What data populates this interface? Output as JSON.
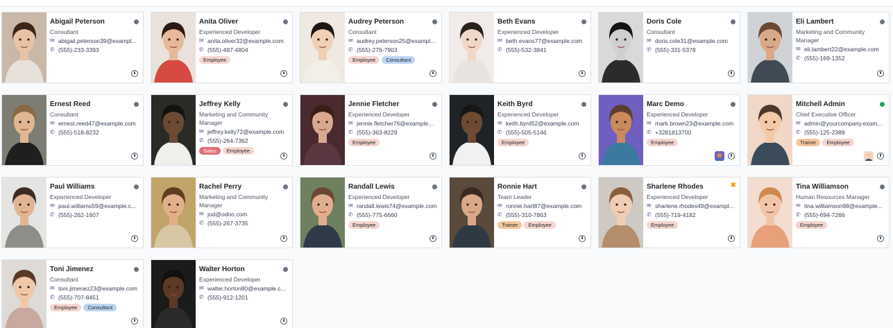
{
  "employees": [
    {
      "name": "Abigail Peterson",
      "job": "Consultant",
      "email": "abigail.peterson39@exampl...",
      "phone": "(555)-233-3393",
      "tags": [],
      "status": "offline",
      "photo": {
        "bg": "#c9b7a8",
        "skin": "#e8c3a5",
        "hair": "#3b2418",
        "shirt": "#e7e1da"
      }
    },
    {
      "name": "Anita Oliver",
      "job": "Experienced Developer",
      "email": "anita.oliver32@example.com",
      "phone": "(555)-497-4804",
      "tags": [
        {
          "label": "Employee",
          "kind": "employee"
        }
      ],
      "status": "offline",
      "photo": {
        "bg": "#e9e2dc",
        "skin": "#e7b89a",
        "hair": "#2c1a12",
        "shirt": "#d64a43"
      }
    },
    {
      "name": "Audrey Peterson",
      "job": "Consultant",
      "email": "audrey.peterson25@exampl...",
      "phone": "(555)-276-7903",
      "tags": [
        {
          "label": "Employee",
          "kind": "employee"
        },
        {
          "label": "Consultant",
          "kind": "consultant"
        }
      ],
      "status": "offline",
      "photo": {
        "bg": "#efe9e2",
        "skin": "#f0cfb4",
        "hair": "#1f1512",
        "shirt": "#f2efe9"
      }
    },
    {
      "name": "Beth Evans",
      "job": "Experienced Developer",
      "email": "beth.evans77@example.com",
      "phone": "(555)-532-3841",
      "tags": [],
      "status": "offline",
      "photo": {
        "bg": "#f1ecea",
        "skin": "#f0d7c7",
        "hair": "#2a211d",
        "shirt": "#e9e3df"
      }
    },
    {
      "name": "Doris Cole",
      "job": "Consultant",
      "email": "doris.cole31@example.com",
      "phone": "(555)-331-5378",
      "tags": [],
      "status": "offline",
      "photo": {
        "bg": "#d9d9d9",
        "skin": "#cfcfcf",
        "hair": "#141414",
        "shirt": "#2b2b2b"
      }
    },
    {
      "name": "Eli Lambert",
      "job": "Marketing and Community Manager",
      "email": "eli.lambert22@example.com",
      "phone": "(555)-169-1352",
      "tags": [],
      "status": "offline",
      "photo": {
        "bg": "#cfd3d6",
        "skin": "#d9a98a",
        "hair": "#6b4a33",
        "shirt": "#3f4a55"
      }
    },
    {
      "name": "Ernest Reed",
      "job": "Consultant",
      "email": "ernest.reed47@example.com",
      "phone": "(555)-518-8232",
      "tags": [],
      "status": "offline",
      "photo": {
        "bg": "#7d7d74",
        "skin": "#e2b693",
        "hair": "#8a6a45",
        "shirt": "#1f1f1f"
      }
    },
    {
      "name": "Jeffrey Kelly",
      "job": "Marketing and Community Manager",
      "email": "jeffrey.kelly72@example.com",
      "phone": "(555)-264-7362",
      "tags": [
        {
          "label": "Sales",
          "kind": "sales"
        },
        {
          "label": "Employee",
          "kind": "employee"
        }
      ],
      "status": "offline",
      "photo": {
        "bg": "#2a2a26",
        "skin": "#6b4a33",
        "hair": "#121212",
        "shirt": "#efefec"
      }
    },
    {
      "name": "Jennie Fletcher",
      "job": "Experienced Developer",
      "email": "jennie.fletcher76@example...",
      "phone": "(555)-363-8229",
      "tags": [
        {
          "label": "Employee",
          "kind": "employee"
        }
      ],
      "status": "offline",
      "photo": {
        "bg": "#4a2a2e",
        "skin": "#d8a88f",
        "hair": "#3a1d17",
        "shirt": "#5a3640"
      }
    },
    {
      "name": "Keith Byrd",
      "job": "Experienced Developer",
      "email": "keith.byrd52@example.com",
      "phone": "(555)-505-5146",
      "tags": [
        {
          "label": "Employee",
          "kind": "employee"
        }
      ],
      "status": "offline",
      "photo": {
        "bg": "#1f2326",
        "skin": "#6e4a33",
        "hair": "#161616",
        "shirt": "#f1f1f1"
      }
    },
    {
      "name": "Marc Demo",
      "job": "Experienced Developer",
      "email": "mark.brown23@example.com",
      "phone": "+3281813700",
      "tags": [
        {
          "label": "Employee",
          "kind": "employee"
        }
      ],
      "status": "offline",
      "mini": true,
      "photo": {
        "bg": "#6f5fc0",
        "skin": "#c98b5d",
        "hair": "#5b3f2c",
        "shirt": "#3b7a9e"
      }
    },
    {
      "name": "Mitchell Admin",
      "job": "Chief Executive Officer",
      "email": "admin@yourcompany.exam...",
      "phone": "(555)-125-2389",
      "tags": [
        {
          "label": "Trainer",
          "kind": "trainer"
        },
        {
          "label": "Employee",
          "kind": "employee"
        }
      ],
      "status": "online",
      "mini": true,
      "photo": {
        "bg": "#f1d7c8",
        "skin": "#f3c9a8",
        "hair": "#4d372a",
        "shirt": "#3b4b5a"
      }
    },
    {
      "name": "Paul Williams",
      "job": "Experienced Developer",
      "email": "paul.williams59@example.c...",
      "phone": "(555)-262-1607",
      "tags": [],
      "status": "offline",
      "photo": {
        "bg": "#e4e4e2",
        "skin": "#e2b592",
        "hair": "#3d2b22",
        "shirt": "#8d8d8a"
      }
    },
    {
      "name": "Rachel Perry",
      "job": "Marketing and Community Manager",
      "email": "jod@odoo.com",
      "phone": "(555)-267-3735",
      "tags": [],
      "status": "offline",
      "photo": {
        "bg": "#c0a46a",
        "skin": "#e1b08b",
        "hair": "#5d3e21",
        "shirt": "#d8c7a4"
      }
    },
    {
      "name": "Randall Lewis",
      "job": "Experienced Developer",
      "email": "randall.lewis74@example.com",
      "phone": "(555)-775-6660",
      "tags": [
        {
          "label": "Employee",
          "kind": "employee"
        }
      ],
      "status": "offline",
      "photo": {
        "bg": "#6f8060",
        "skin": "#e0ae8e",
        "hair": "#6a4733",
        "shirt": "#2f3a48"
      }
    },
    {
      "name": "Ronnie Hart",
      "job": "Team Leader",
      "email": "ronnie.hart87@example.com",
      "phone": "(555)-310-7863",
      "tags": [
        {
          "label": "Trainer",
          "kind": "trainer"
        },
        {
          "label": "Employee",
          "kind": "employee"
        }
      ],
      "status": "offline",
      "photo": {
        "bg": "#5a4a3c",
        "skin": "#d9a887",
        "hair": "#3b2a20",
        "shirt": "#2e3944"
      }
    },
    {
      "name": "Sharlene Rhodes",
      "job": "Experienced Developer",
      "email": "sharlene.rhodes49@exampl...",
      "phone": "(555)-719-4182",
      "tags": [
        {
          "label": "Employee",
          "kind": "employee"
        }
      ],
      "status": "away",
      "photo": {
        "bg": "#cfc9c3",
        "skin": "#f0cdb4",
        "hair": "#8c5e3c",
        "shirt": "#b48d6c"
      }
    },
    {
      "name": "Tina Williamson",
      "job": "Human Resources Manager",
      "email": "tina.williamson98@example...",
      "phone": "(555)-694-7266",
      "tags": [
        {
          "label": "Employee",
          "kind": "employee"
        }
      ],
      "status": "offline",
      "photo": {
        "bg": "#f3ddd0",
        "skin": "#f2c4a8",
        "hair": "#d08a4f",
        "shirt": "#e7a07a"
      }
    },
    {
      "name": "Toni Jimenez",
      "job": "Consultant",
      "email": "toni.jimenez23@example.com",
      "phone": "(555)-707-8451",
      "tags": [
        {
          "label": "Employee",
          "kind": "employee"
        },
        {
          "label": "Consultant",
          "kind": "consultant"
        }
      ],
      "status": "offline",
      "photo": {
        "bg": "#dedad6",
        "skin": "#f0c8a8",
        "hair": "#5a3a26",
        "shirt": "#c7a9a0"
      }
    },
    {
      "name": "Walter Horton",
      "job": "Experienced Developer",
      "email": "walter.horton80@example.c...",
      "phone": "(555)-912-1201",
      "tags": [],
      "status": "offline",
      "photo": {
        "bg": "#1b1b1b",
        "skin": "#5d3a26",
        "hair": "#101010",
        "shirt": "#2a2a2a"
      }
    }
  ],
  "icons": {
    "email": "envelope-icon",
    "phone": "phone-icon",
    "activity": "clock-icon"
  }
}
